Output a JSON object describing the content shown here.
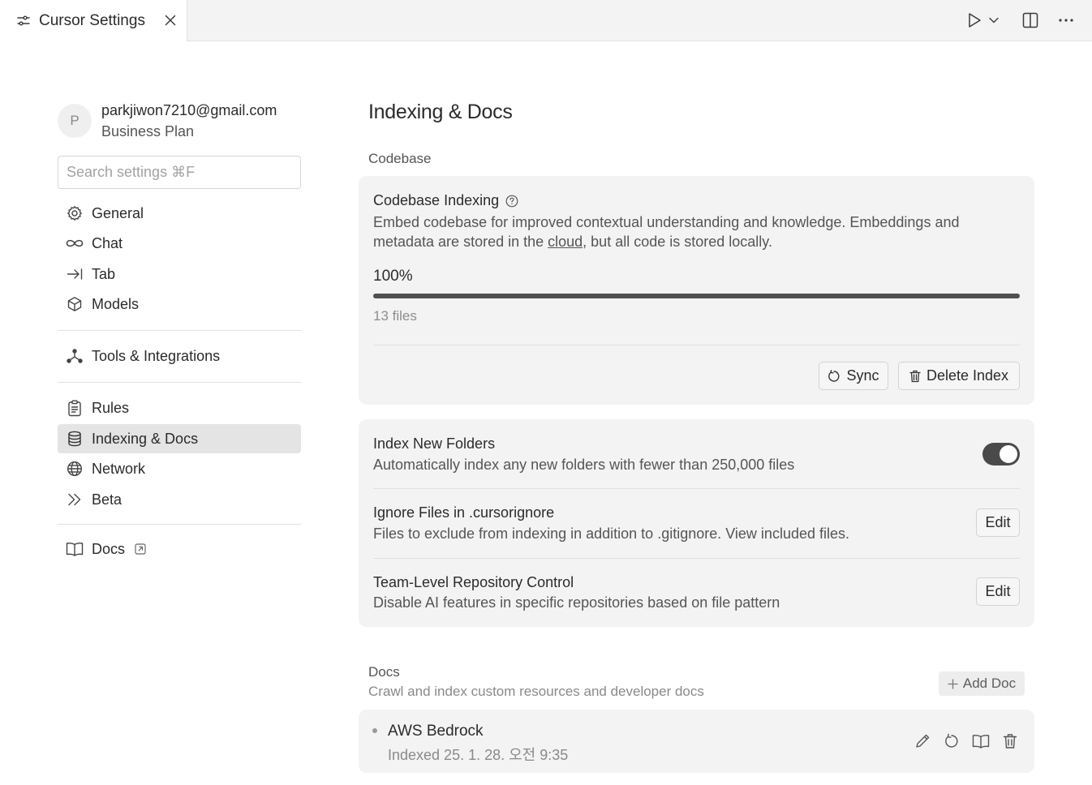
{
  "tab": {
    "title": "Cursor Settings",
    "icon": "sliders-icon",
    "close_icon": "close-icon"
  },
  "top_actions": [
    {
      "name": "run-button",
      "icon": "play-icon"
    },
    {
      "name": "run-dropdown-button",
      "icon": "chevron-down-icon"
    },
    {
      "name": "split-editor-button",
      "icon": "split-layout-icon"
    },
    {
      "name": "more-actions-button",
      "icon": "ellipsis-icon"
    }
  ],
  "profile": {
    "avatar_initial": "P",
    "email": "parkjiwon7210@gmail.com",
    "plan": "Business Plan"
  },
  "search": {
    "placeholder": "Search settings ⌘F"
  },
  "sidebar": {
    "items": [
      {
        "label": "General",
        "icon": "gear-icon"
      },
      {
        "label": "Chat",
        "icon": "infinity-icon"
      },
      {
        "label": "Tab",
        "icon": "tab-arrow-icon"
      },
      {
        "label": "Models",
        "icon": "cube-icon"
      },
      {
        "label": "Tools & Integrations",
        "icon": "network-nodes-icon"
      },
      {
        "label": "Rules",
        "icon": "clipboard-icon"
      },
      {
        "label": "Indexing & Docs",
        "icon": "database-icon",
        "active": true
      },
      {
        "label": "Network",
        "icon": "globe-icon"
      },
      {
        "label": "Beta",
        "icon": "double-chevron-right-icon"
      },
      {
        "label": "Docs",
        "icon": "book-icon",
        "external_icon": "external-link-icon"
      }
    ]
  },
  "main": {
    "title": "Indexing & Docs",
    "codebase_section_label": "Codebase",
    "codebase": {
      "title": "Codebase Indexing",
      "help_icon": "help-circle-icon",
      "description_before_link": "Embed codebase for improved contextual understanding and knowledge. Embeddings and metadata are stored in the ",
      "description_link": "cloud",
      "description_after_link": ", but all code is stored locally.",
      "progress_text": "100%",
      "progress_value": 1.0,
      "files_text": "13 files",
      "sync_label": "Sync",
      "delete_label": "Delete Index"
    },
    "settings": [
      {
        "title": "Index New Folders",
        "description": "Automatically index any new folders with fewer than 250,000 files",
        "control": "toggle",
        "enabled": true
      },
      {
        "title": "Ignore Files in .cursorignore",
        "description": "Files to exclude from indexing in addition to .gitignore. View included files.",
        "control": "button",
        "button_label": "Edit"
      },
      {
        "title": "Team-Level Repository Control",
        "description": "Disable AI features in specific repositories based on file pattern",
        "control": "button",
        "button_label": "Edit"
      }
    ],
    "docs": {
      "label": "Docs",
      "description": "Crawl and index custom resources and developer docs",
      "add_label": "Add Doc",
      "items": [
        {
          "name": "AWS Bedrock",
          "date": "Indexed 25. 1. 28. 오전 9:35"
        }
      ]
    }
  }
}
